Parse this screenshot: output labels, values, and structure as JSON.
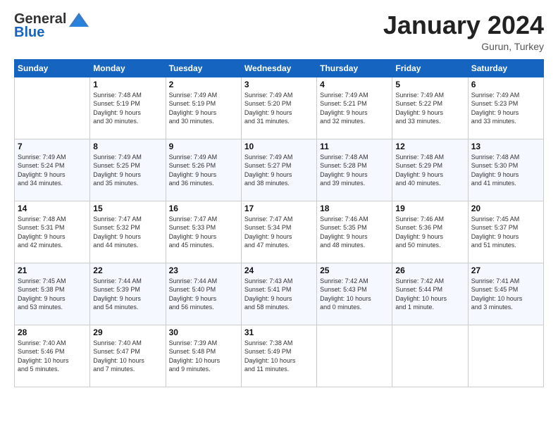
{
  "logo": {
    "general": "General",
    "blue": "Blue"
  },
  "title": "January 2024",
  "subtitle": "Gurun, Turkey",
  "header_days": [
    "Sunday",
    "Monday",
    "Tuesday",
    "Wednesday",
    "Thursday",
    "Friday",
    "Saturday"
  ],
  "weeks": [
    [
      {
        "day": "",
        "info": ""
      },
      {
        "day": "1",
        "info": "Sunrise: 7:48 AM\nSunset: 5:19 PM\nDaylight: 9 hours\nand 30 minutes."
      },
      {
        "day": "2",
        "info": "Sunrise: 7:49 AM\nSunset: 5:19 PM\nDaylight: 9 hours\nand 30 minutes."
      },
      {
        "day": "3",
        "info": "Sunrise: 7:49 AM\nSunset: 5:20 PM\nDaylight: 9 hours\nand 31 minutes."
      },
      {
        "day": "4",
        "info": "Sunrise: 7:49 AM\nSunset: 5:21 PM\nDaylight: 9 hours\nand 32 minutes."
      },
      {
        "day": "5",
        "info": "Sunrise: 7:49 AM\nSunset: 5:22 PM\nDaylight: 9 hours\nand 33 minutes."
      },
      {
        "day": "6",
        "info": "Sunrise: 7:49 AM\nSunset: 5:23 PM\nDaylight: 9 hours\nand 33 minutes."
      }
    ],
    [
      {
        "day": "7",
        "info": "Sunrise: 7:49 AM\nSunset: 5:24 PM\nDaylight: 9 hours\nand 34 minutes."
      },
      {
        "day": "8",
        "info": "Sunrise: 7:49 AM\nSunset: 5:25 PM\nDaylight: 9 hours\nand 35 minutes."
      },
      {
        "day": "9",
        "info": "Sunrise: 7:49 AM\nSunset: 5:26 PM\nDaylight: 9 hours\nand 36 minutes."
      },
      {
        "day": "10",
        "info": "Sunrise: 7:49 AM\nSunset: 5:27 PM\nDaylight: 9 hours\nand 38 minutes."
      },
      {
        "day": "11",
        "info": "Sunrise: 7:48 AM\nSunset: 5:28 PM\nDaylight: 9 hours\nand 39 minutes."
      },
      {
        "day": "12",
        "info": "Sunrise: 7:48 AM\nSunset: 5:29 PM\nDaylight: 9 hours\nand 40 minutes."
      },
      {
        "day": "13",
        "info": "Sunrise: 7:48 AM\nSunset: 5:30 PM\nDaylight: 9 hours\nand 41 minutes."
      }
    ],
    [
      {
        "day": "14",
        "info": "Sunrise: 7:48 AM\nSunset: 5:31 PM\nDaylight: 9 hours\nand 42 minutes."
      },
      {
        "day": "15",
        "info": "Sunrise: 7:47 AM\nSunset: 5:32 PM\nDaylight: 9 hours\nand 44 minutes."
      },
      {
        "day": "16",
        "info": "Sunrise: 7:47 AM\nSunset: 5:33 PM\nDaylight: 9 hours\nand 45 minutes."
      },
      {
        "day": "17",
        "info": "Sunrise: 7:47 AM\nSunset: 5:34 PM\nDaylight: 9 hours\nand 47 minutes."
      },
      {
        "day": "18",
        "info": "Sunrise: 7:46 AM\nSunset: 5:35 PM\nDaylight: 9 hours\nand 48 minutes."
      },
      {
        "day": "19",
        "info": "Sunrise: 7:46 AM\nSunset: 5:36 PM\nDaylight: 9 hours\nand 50 minutes."
      },
      {
        "day": "20",
        "info": "Sunrise: 7:45 AM\nSunset: 5:37 PM\nDaylight: 9 hours\nand 51 minutes."
      }
    ],
    [
      {
        "day": "21",
        "info": "Sunrise: 7:45 AM\nSunset: 5:38 PM\nDaylight: 9 hours\nand 53 minutes."
      },
      {
        "day": "22",
        "info": "Sunrise: 7:44 AM\nSunset: 5:39 PM\nDaylight: 9 hours\nand 54 minutes."
      },
      {
        "day": "23",
        "info": "Sunrise: 7:44 AM\nSunset: 5:40 PM\nDaylight: 9 hours\nand 56 minutes."
      },
      {
        "day": "24",
        "info": "Sunrise: 7:43 AM\nSunset: 5:41 PM\nDaylight: 9 hours\nand 58 minutes."
      },
      {
        "day": "25",
        "info": "Sunrise: 7:42 AM\nSunset: 5:43 PM\nDaylight: 10 hours\nand 0 minutes."
      },
      {
        "day": "26",
        "info": "Sunrise: 7:42 AM\nSunset: 5:44 PM\nDaylight: 10 hours\nand 1 minute."
      },
      {
        "day": "27",
        "info": "Sunrise: 7:41 AM\nSunset: 5:45 PM\nDaylight: 10 hours\nand 3 minutes."
      }
    ],
    [
      {
        "day": "28",
        "info": "Sunrise: 7:40 AM\nSunset: 5:46 PM\nDaylight: 10 hours\nand 5 minutes."
      },
      {
        "day": "29",
        "info": "Sunrise: 7:40 AM\nSunset: 5:47 PM\nDaylight: 10 hours\nand 7 minutes."
      },
      {
        "day": "30",
        "info": "Sunrise: 7:39 AM\nSunset: 5:48 PM\nDaylight: 10 hours\nand 9 minutes."
      },
      {
        "day": "31",
        "info": "Sunrise: 7:38 AM\nSunset: 5:49 PM\nDaylight: 10 hours\nand 11 minutes."
      },
      {
        "day": "",
        "info": ""
      },
      {
        "day": "",
        "info": ""
      },
      {
        "day": "",
        "info": ""
      }
    ]
  ]
}
